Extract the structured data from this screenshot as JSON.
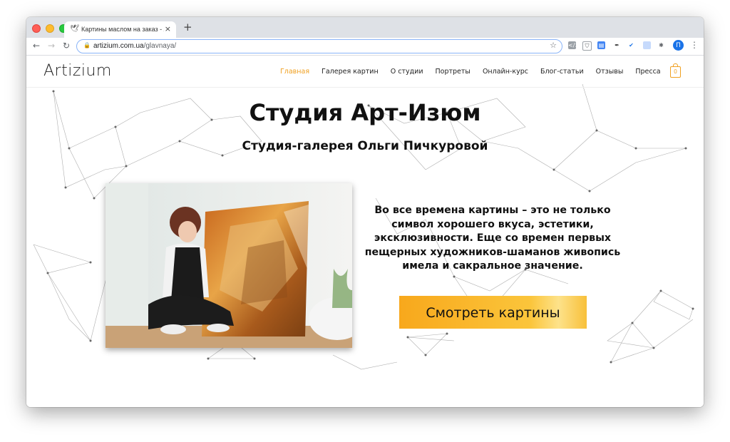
{
  "browser": {
    "tab_title": "Картины маслом на заказ - А",
    "tab_favicon": "bird-icon",
    "url_domain": "artizium.com.ua",
    "url_path": "/glavnaya/",
    "profile_initial": "П"
  },
  "site": {
    "logo": "Artizium",
    "nav": [
      {
        "label": "Главная",
        "active": true
      },
      {
        "label": "Галерея картин",
        "active": false
      },
      {
        "label": "О студии",
        "active": false
      },
      {
        "label": "Портреты",
        "active": false
      },
      {
        "label": "Онлайн-курс",
        "active": false
      },
      {
        "label": "Блог-статьи",
        "active": false
      },
      {
        "label": "Отзывы",
        "active": false
      },
      {
        "label": "Пресса",
        "active": false
      }
    ],
    "cart_count": "0",
    "accent_color": "#f0a020"
  },
  "hero": {
    "title": "Студия Арт-Изюм",
    "subtitle": "Студия-галерея Ольги Пичкуровой",
    "description": "Во все времена картины – это не только символ хорошего вкуса, эстетики, эксклюзивности. Еще со времен первых пещерных художников-шаманов живопись имела и сакральное значение.",
    "cta_label": "Смотреть картины",
    "photo": "artist-with-painting-photo"
  }
}
